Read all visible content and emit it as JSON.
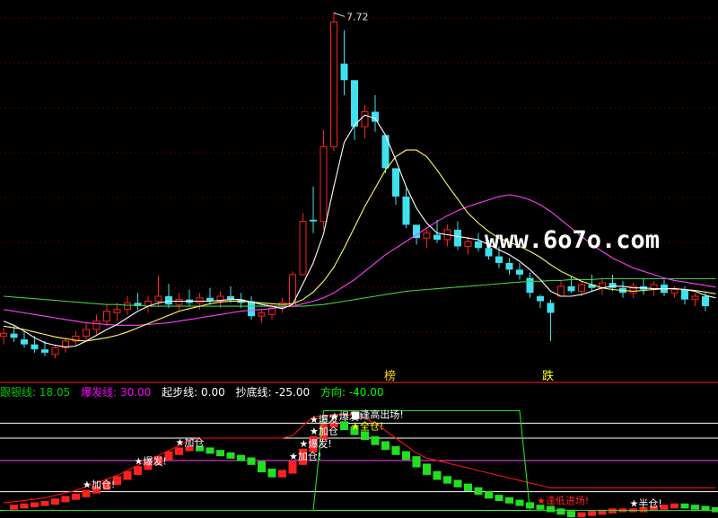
{
  "watermark": "www.6o7o.com",
  "high_label": "7.72",
  "period_labels": [
    {
      "text": "榜",
      "color": "#FFD700"
    },
    {
      "text": "跌",
      "color": "#FFFF00"
    }
  ],
  "legend": [
    {
      "name": "跟银线",
      "value": "18.05",
      "color": "#00CC00"
    },
    {
      "name": "爆发线",
      "value": "30.00",
      "color": "#FF00FF"
    },
    {
      "name": "起步线",
      "value": "0.00",
      "color": "#FFFFFF"
    },
    {
      "name": "抄底线",
      "value": "-25.00",
      "color": "#FFFFFF"
    },
    {
      "name": "方向",
      "value": "-40.00",
      "color": "#00FF00"
    }
  ],
  "colors": {
    "up": "#FF2020",
    "down": "#40E0F0",
    "ma5": "#FFFFFF",
    "ma10": "#FFFF60",
    "ma20": "#FF40FF",
    "ma60": "#40D040"
  },
  "chart_data": [
    {
      "type": "candlestick",
      "title": "",
      "high_marker": 7.72,
      "candles": [
        {
          "o": 3.82,
          "h": 3.92,
          "l": 3.72,
          "c": 3.85
        },
        {
          "o": 3.85,
          "h": 3.95,
          "l": 3.75,
          "c": 3.8
        },
        {
          "o": 3.78,
          "h": 3.88,
          "l": 3.68,
          "c": 3.72
        },
        {
          "o": 3.72,
          "h": 3.82,
          "l": 3.62,
          "c": 3.66
        },
        {
          "o": 3.66,
          "h": 3.76,
          "l": 3.58,
          "c": 3.62
        },
        {
          "o": 3.6,
          "h": 3.72,
          "l": 3.55,
          "c": 3.68
        },
        {
          "o": 3.68,
          "h": 3.8,
          "l": 3.62,
          "c": 3.76
        },
        {
          "o": 3.76,
          "h": 3.88,
          "l": 3.7,
          "c": 3.82
        },
        {
          "o": 3.82,
          "h": 3.98,
          "l": 3.76,
          "c": 3.9
        },
        {
          "o": 3.9,
          "h": 4.08,
          "l": 3.84,
          "c": 4.0
        },
        {
          "o": 4.0,
          "h": 4.2,
          "l": 3.94,
          "c": 4.12
        },
        {
          "o": 4.1,
          "h": 4.22,
          "l": 4.0,
          "c": 4.14
        },
        {
          "o": 4.14,
          "h": 4.3,
          "l": 4.08,
          "c": 4.22
        },
        {
          "o": 4.22,
          "h": 4.34,
          "l": 4.14,
          "c": 4.18
        },
        {
          "o": 4.18,
          "h": 4.3,
          "l": 4.1,
          "c": 4.24
        },
        {
          "o": 4.24,
          "h": 4.55,
          "l": 4.18,
          "c": 4.3
        },
        {
          "o": 4.3,
          "h": 4.45,
          "l": 4.16,
          "c": 4.2
        },
        {
          "o": 4.2,
          "h": 4.34,
          "l": 4.12,
          "c": 4.26
        },
        {
          "o": 4.26,
          "h": 4.38,
          "l": 4.18,
          "c": 4.22
        },
        {
          "o": 4.22,
          "h": 4.34,
          "l": 4.14,
          "c": 4.28
        },
        {
          "o": 4.28,
          "h": 4.4,
          "l": 4.2,
          "c": 4.24
        },
        {
          "o": 4.24,
          "h": 4.36,
          "l": 4.16,
          "c": 4.3
        },
        {
          "o": 4.3,
          "h": 4.42,
          "l": 4.22,
          "c": 4.26
        },
        {
          "o": 4.26,
          "h": 4.34,
          "l": 4.16,
          "c": 4.22
        },
        {
          "o": 4.24,
          "h": 4.3,
          "l": 4.02,
          "c": 4.06
        },
        {
          "o": 4.06,
          "h": 4.14,
          "l": 3.98,
          "c": 4.1
        },
        {
          "o": 4.08,
          "h": 4.2,
          "l": 4.02,
          "c": 4.16
        },
        {
          "o": 4.16,
          "h": 4.28,
          "l": 4.1,
          "c": 4.22
        },
        {
          "o": 4.18,
          "h": 4.6,
          "l": 4.16,
          "c": 4.56
        },
        {
          "o": 4.56,
          "h": 5.3,
          "l": 4.56,
          "c": 5.2
        },
        {
          "o": 5.22,
          "h": 5.62,
          "l": 5.06,
          "c": 5.2
        },
        {
          "o": 5.2,
          "h": 6.3,
          "l": 5.1,
          "c": 6.1
        },
        {
          "o": 6.1,
          "h": 7.72,
          "l": 6.05,
          "c": 7.6
        },
        {
          "o": 7.1,
          "h": 7.5,
          "l": 6.72,
          "c": 6.9
        },
        {
          "o": 6.9,
          "h": 6.9,
          "l": 6.18,
          "c": 6.34
        },
        {
          "o": 6.34,
          "h": 6.6,
          "l": 6.2,
          "c": 6.52
        },
        {
          "o": 6.52,
          "h": 6.72,
          "l": 6.28,
          "c": 6.4
        },
        {
          "o": 6.24,
          "h": 6.24,
          "l": 5.78,
          "c": 5.84
        },
        {
          "o": 5.84,
          "h": 5.84,
          "l": 5.4,
          "c": 5.5
        },
        {
          "o": 5.5,
          "h": 5.6,
          "l": 5.12,
          "c": 5.16
        },
        {
          "o": 5.16,
          "h": 5.16,
          "l": 4.92,
          "c": 5.0
        },
        {
          "o": 5.0,
          "h": 5.1,
          "l": 4.88,
          "c": 5.06
        },
        {
          "o": 5.04,
          "h": 5.22,
          "l": 4.94,
          "c": 4.98
        },
        {
          "o": 4.98,
          "h": 5.16,
          "l": 4.9,
          "c": 5.1
        },
        {
          "o": 5.1,
          "h": 5.2,
          "l": 4.86,
          "c": 4.9
        },
        {
          "o": 4.9,
          "h": 5.02,
          "l": 4.8,
          "c": 4.96
        },
        {
          "o": 4.96,
          "h": 5.06,
          "l": 4.84,
          "c": 4.88
        },
        {
          "o": 4.88,
          "h": 4.98,
          "l": 4.74,
          "c": 4.78
        },
        {
          "o": 4.78,
          "h": 4.9,
          "l": 4.64,
          "c": 4.7
        },
        {
          "o": 4.7,
          "h": 4.76,
          "l": 4.56,
          "c": 4.62
        },
        {
          "o": 4.62,
          "h": 4.7,
          "l": 4.5,
          "c": 4.56
        },
        {
          "o": 4.52,
          "h": 4.58,
          "l": 4.28,
          "c": 4.34
        },
        {
          "o": 4.3,
          "h": 4.32,
          "l": 4.16,
          "c": 4.24
        },
        {
          "o": 4.22,
          "h": 4.26,
          "l": 3.76,
          "c": 4.1
        },
        {
          "o": 4.3,
          "h": 4.48,
          "l": 4.3,
          "c": 4.42
        },
        {
          "o": 4.42,
          "h": 4.54,
          "l": 4.34,
          "c": 4.36
        },
        {
          "o": 4.36,
          "h": 4.48,
          "l": 4.3,
          "c": 4.44
        },
        {
          "o": 4.44,
          "h": 4.56,
          "l": 4.36,
          "c": 4.4
        },
        {
          "o": 4.4,
          "h": 4.52,
          "l": 4.32,
          "c": 4.46
        },
        {
          "o": 4.46,
          "h": 4.56,
          "l": 4.36,
          "c": 4.4
        },
        {
          "o": 4.4,
          "h": 4.48,
          "l": 4.28,
          "c": 4.34
        },
        {
          "o": 4.34,
          "h": 4.46,
          "l": 4.28,
          "c": 4.42
        },
        {
          "o": 4.42,
          "h": 4.52,
          "l": 4.32,
          "c": 4.38
        },
        {
          "o": 4.38,
          "h": 4.48,
          "l": 4.3,
          "c": 4.44
        },
        {
          "o": 4.44,
          "h": 4.5,
          "l": 4.3,
          "c": 4.34
        },
        {
          "o": 4.34,
          "h": 4.42,
          "l": 4.28,
          "c": 4.38
        },
        {
          "o": 4.38,
          "h": 4.42,
          "l": 4.2,
          "c": 4.26
        },
        {
          "o": 4.26,
          "h": 4.34,
          "l": 4.18,
          "c": 4.3
        },
        {
          "o": 4.3,
          "h": 4.34,
          "l": 4.12,
          "c": 4.18
        }
      ],
      "ma5": [
        4.0,
        3.95,
        3.88,
        3.8,
        3.74,
        3.71,
        3.69,
        3.7,
        3.76,
        3.83,
        3.9,
        3.96,
        4.04,
        4.12,
        4.18,
        4.22,
        4.24,
        4.24,
        4.24,
        4.24,
        4.24,
        4.25,
        4.26,
        4.26,
        4.23,
        4.2,
        4.18,
        4.15,
        4.2,
        4.45,
        4.7,
        5.05,
        5.62,
        6.15,
        6.36,
        6.48,
        6.44,
        6.24,
        5.94,
        5.62,
        5.36,
        5.18,
        5.06,
        5.04,
        5.02,
        5.0,
        4.98,
        4.92,
        4.86,
        4.8,
        4.72,
        4.62,
        4.5,
        4.36,
        4.3,
        4.3,
        4.32,
        4.36,
        4.4,
        4.42,
        4.42,
        4.4,
        4.4,
        4.39,
        4.39,
        4.39,
        4.38,
        4.36,
        4.31,
        4.28
      ],
      "ma10": [
        3.94,
        3.92,
        3.9,
        3.87,
        3.84,
        3.81,
        3.79,
        3.77,
        3.76,
        3.78,
        3.8,
        3.83,
        3.87,
        3.92,
        3.97,
        4.02,
        4.07,
        4.12,
        4.15,
        4.18,
        4.21,
        4.23,
        4.24,
        4.24,
        4.23,
        4.22,
        4.21,
        4.2,
        4.21,
        4.26,
        4.35,
        4.48,
        4.65,
        4.88,
        5.13,
        5.38,
        5.6,
        5.82,
        5.98,
        6.06,
        6.06,
        5.98,
        5.82,
        5.64,
        5.47,
        5.3,
        5.18,
        5.08,
        5.0,
        4.95,
        4.9,
        4.84,
        4.77,
        4.68,
        4.6,
        4.54,
        4.48,
        4.44,
        4.4,
        4.38,
        4.37,
        4.36,
        4.37,
        4.38,
        4.39,
        4.39,
        4.38,
        4.37,
        4.35,
        4.33
      ],
      "ma20": [
        4.14,
        4.12,
        4.1,
        4.08,
        4.06,
        4.04,
        4.02,
        4.0,
        3.98,
        3.97,
        3.96,
        3.95,
        3.95,
        3.95,
        3.96,
        3.97,
        3.98,
        4.0,
        4.02,
        4.04,
        4.06,
        4.08,
        4.1,
        4.12,
        4.13,
        4.14,
        4.15,
        4.17,
        4.18,
        4.21,
        4.24,
        4.28,
        4.34,
        4.42,
        4.5,
        4.6,
        4.7,
        4.8,
        4.88,
        4.96,
        5.04,
        5.12,
        5.2,
        5.27,
        5.33,
        5.38,
        5.42,
        5.46,
        5.5,
        5.52,
        5.5,
        5.46,
        5.4,
        5.32,
        5.22,
        5.12,
        5.02,
        4.92,
        4.84,
        4.76,
        4.7,
        4.64,
        4.6,
        4.56,
        4.52,
        4.49,
        4.47,
        4.45,
        4.43,
        4.41
      ],
      "ma60": [
        4.3,
        4.29,
        4.28,
        4.27,
        4.26,
        4.25,
        4.24,
        4.23,
        4.22,
        4.21,
        4.2,
        4.2,
        4.19,
        4.19,
        4.18,
        4.18,
        4.18,
        4.18,
        4.18,
        4.18,
        4.18,
        4.18,
        4.18,
        4.18,
        4.18,
        4.18,
        4.18,
        4.18,
        4.18,
        4.18,
        4.19,
        4.2,
        4.22,
        4.24,
        4.26,
        4.28,
        4.3,
        4.32,
        4.34,
        4.36,
        4.37,
        4.38,
        4.39,
        4.4,
        4.41,
        4.42,
        4.43,
        4.44,
        4.45,
        4.46,
        4.47,
        4.48,
        4.48,
        4.49,
        4.49,
        4.5,
        4.5,
        4.5,
        4.51,
        4.51,
        4.51,
        4.51,
        4.51,
        4.51,
        4.51,
        4.51,
        4.51,
        4.51,
        4.51,
        4.51
      ]
    },
    {
      "type": "indicator",
      "title": "",
      "levels": [
        30,
        18.05,
        0,
        -25,
        -40
      ],
      "series": [
        {
          "name": "跟银线",
          "values": [
            -38,
            -37,
            -36,
            -35,
            -34,
            -32,
            -30,
            -28,
            -25,
            -22,
            -18,
            -14,
            -10,
            -6,
            -2,
            2,
            6,
            9,
            10,
            9,
            7,
            5,
            3,
            1,
            -2,
            -8,
            -12,
            -9,
            -2,
            8,
            18,
            28,
            30,
            26,
            22,
            18,
            14,
            10,
            6,
            2,
            -4,
            -10,
            -14,
            -17,
            -20,
            -23,
            -26,
            -29,
            -31,
            -33,
            -35,
            -37,
            -38,
            -40,
            -42,
            -44,
            -43,
            -42,
            -41,
            -40,
            -40,
            -40,
            -39,
            -38,
            -37,
            -36,
            -37,
            -38,
            -39,
            -40
          ]
        },
        {
          "name": "爆发线",
          "values": [
            -34,
            -33,
            -32,
            -31,
            -30,
            -28,
            -26,
            -24,
            -21,
            -18,
            -15,
            -12,
            -8,
            -4,
            0,
            4,
            8,
            12,
            16,
            18,
            18,
            18,
            18,
            18,
            18,
            18,
            18,
            18,
            20,
            28,
            35,
            36,
            37,
            37,
            36,
            34,
            30,
            24,
            18,
            12,
            6,
            2,
            0,
            -2,
            -4,
            -6,
            -8,
            -10,
            -12,
            -14,
            -16,
            -18,
            -20,
            -22,
            -22,
            -22,
            -22,
            -22,
            -22,
            -22,
            -22,
            -22,
            -22,
            -22,
            -22,
            -22,
            -22,
            -22,
            -22,
            -22
          ]
        },
        {
          "name": "方向",
          "values": [
            -40,
            -40,
            -40,
            -40,
            -40,
            -40,
            -40,
            -40,
            -40,
            -40,
            -40,
            -40,
            -40,
            -40,
            -40,
            -40,
            -40,
            -40,
            -40,
            -40,
            -40,
            -40,
            -40,
            -40,
            -40,
            -40,
            -40,
            -40,
            -40,
            -40,
            -40,
            40,
            40,
            40,
            40,
            40,
            40,
            40,
            40,
            40,
            40,
            40,
            40,
            40,
            40,
            40,
            40,
            40,
            40,
            40,
            40,
            -40,
            -40,
            -40,
            -40,
            -40,
            -40,
            -40,
            -40,
            -40,
            -40,
            -40,
            -40,
            -40,
            -40,
            -40,
            -40,
            -40,
            -40,
            -40
          ]
        }
      ],
      "signals": [
        {
          "idx": 8,
          "text": "★加仓!",
          "color": "#FFFFFF"
        },
        {
          "idx": 13,
          "text": "★爆发!",
          "color": "#FFFFFF"
        },
        {
          "idx": 17,
          "text": "★加仓",
          "color": "#FFFFFF"
        },
        {
          "idx": 28,
          "text": "★加仓!",
          "color": "#FFFFFF"
        },
        {
          "idx": 29,
          "text": "★爆发!",
          "color": "#FFFFFF"
        },
        {
          "idx": 30,
          "text": "★加仓",
          "color": "#FFFFFF"
        },
        {
          "idx": 30,
          "text": "★爆发",
          "color": "#FFFFFF"
        },
        {
          "idx": 32,
          "text": "★爆发!",
          "color": "#FFFFFF"
        },
        {
          "idx": 34,
          "text": "★全仓!",
          "color": "#FFFF00"
        },
        {
          "idx": 34,
          "text": "■逢高出场!",
          "color": "#FFFFFF"
        },
        {
          "idx": 52,
          "text": "★逢低进场!",
          "color": "#FF2020"
        },
        {
          "idx": 61,
          "text": "★半仓!",
          "color": "#FFFFFF"
        }
      ]
    }
  ]
}
